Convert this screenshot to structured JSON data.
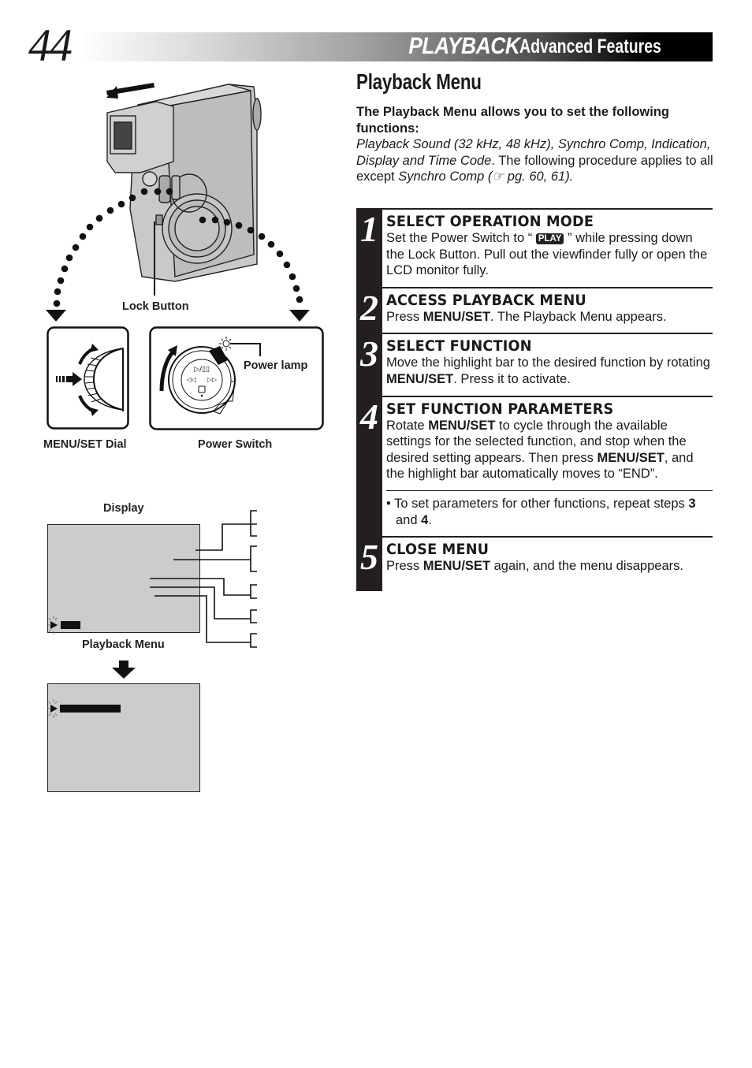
{
  "header": {
    "page_number": "44",
    "title_main": "PLAYBACK",
    "title_sub": "Advanced Features"
  },
  "section": {
    "title": "Playback Menu",
    "intro_lead": "The Playback Menu allows you to set the following functions:",
    "intro_functions": "Playback Sound (32 kHz, 48 kHz), Synchro Comp, Indication, Display and Time Code",
    "intro_after": ". The following procedure applies to all except ",
    "intro_except": "Synchro Comp",
    "intro_ref": " (☞ pg. 60, 61)."
  },
  "steps": [
    {
      "number": "1",
      "title": "SELECT OPERATION MODE",
      "body_pre": "Set the Power Switch to “ ",
      "badge": "PLAY",
      "body_post": " ” while pressing down the Lock Button. Pull out the viewfinder fully or open the LCD monitor fully."
    },
    {
      "number": "2",
      "title": "ACCESS PLAYBACK MENU",
      "body_pre": "Press ",
      "bold": "MENU/SET",
      "body_post": ". The Playback Menu appears."
    },
    {
      "number": "3",
      "title": "SELECT FUNCTION",
      "body_pre": "Move the highlight bar to the desired function by rotating ",
      "bold": "MENU/SET",
      "body_post": ". Press it to activate."
    },
    {
      "number": "4",
      "title": "SET FUNCTION PARAMETERS",
      "body_a": "Rotate ",
      "bold_a": "MENU/SET",
      "body_b": " to cycle through the available settings for the selected function, and stop when the desired setting appears. Then press ",
      "bold_b": "MENU/SET",
      "body_c": ", and the highlight bar automatically moves to “END”.",
      "note_pre": "• To set parameters for other functions, repeat steps ",
      "note_b1": "3",
      "note_mid": " and ",
      "note_b2": "4",
      "note_end": "."
    },
    {
      "number": "5",
      "title": "CLOSE MENU",
      "body_pre": "Press ",
      "bold": "MENU/SET",
      "body_post": " again, and the menu disappears."
    }
  ],
  "diagrams": {
    "lock_button_label": "Lock Button",
    "menu_set_dial_label": "MENU/SET Dial",
    "power_switch_label": "Power Switch",
    "power_lamp_label": "Power lamp",
    "display_label": "Display",
    "playback_menu_label": "Playback Menu"
  }
}
